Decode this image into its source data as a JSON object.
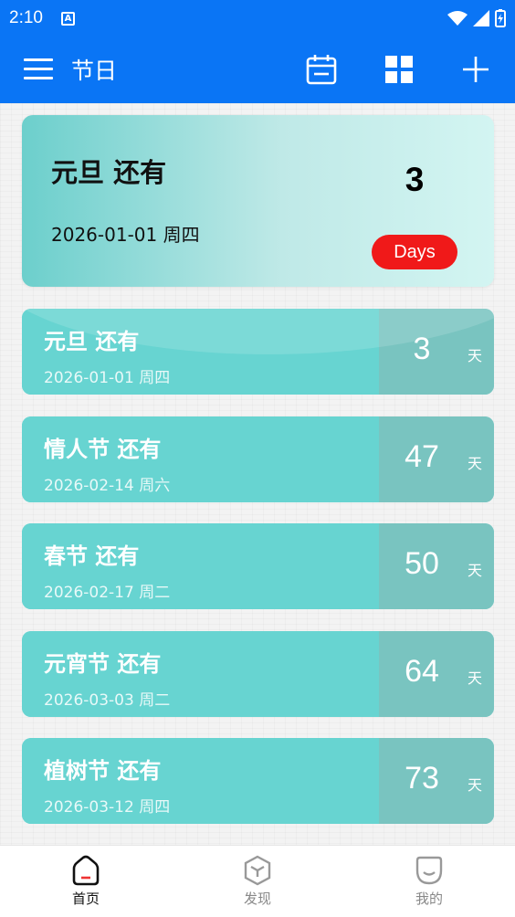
{
  "status_bar": {
    "time": "2:10",
    "badge": "A"
  },
  "app_bar": {
    "title": "节日",
    "icons": [
      "menu-icon",
      "calendar-icon",
      "grid-icon",
      "plus-icon"
    ]
  },
  "featured": {
    "title": "元旦 还有",
    "date": "2026-01-01 周四",
    "count": "3",
    "unit_badge": "Days",
    "badge_color": "#f01919"
  },
  "holidays": [
    {
      "title": "元旦 还有",
      "date": "2026-01-01 周四",
      "count": "3",
      "unit": "天"
    },
    {
      "title": "情人节 还有",
      "date": "2026-02-14 周六",
      "count": "47",
      "unit": "天"
    },
    {
      "title": "春节 还有",
      "date": "2026-02-17 周二",
      "count": "50",
      "unit": "天"
    },
    {
      "title": "元宵节 还有",
      "date": "2026-03-03 周二",
      "count": "64",
      "unit": "天"
    },
    {
      "title": "植树节 还有",
      "date": "2026-03-12 周四",
      "count": "73",
      "unit": "天"
    }
  ],
  "bottom_nav": {
    "items": [
      {
        "label": "首页",
        "icon": "home-icon",
        "active": true
      },
      {
        "label": "发现",
        "icon": "discover-icon",
        "active": false
      },
      {
        "label": "我的",
        "icon": "profile-icon",
        "active": false
      }
    ]
  },
  "colors": {
    "primary": "#0a75f5",
    "card": "#67d4d1",
    "card_side": "#79c4c0"
  }
}
